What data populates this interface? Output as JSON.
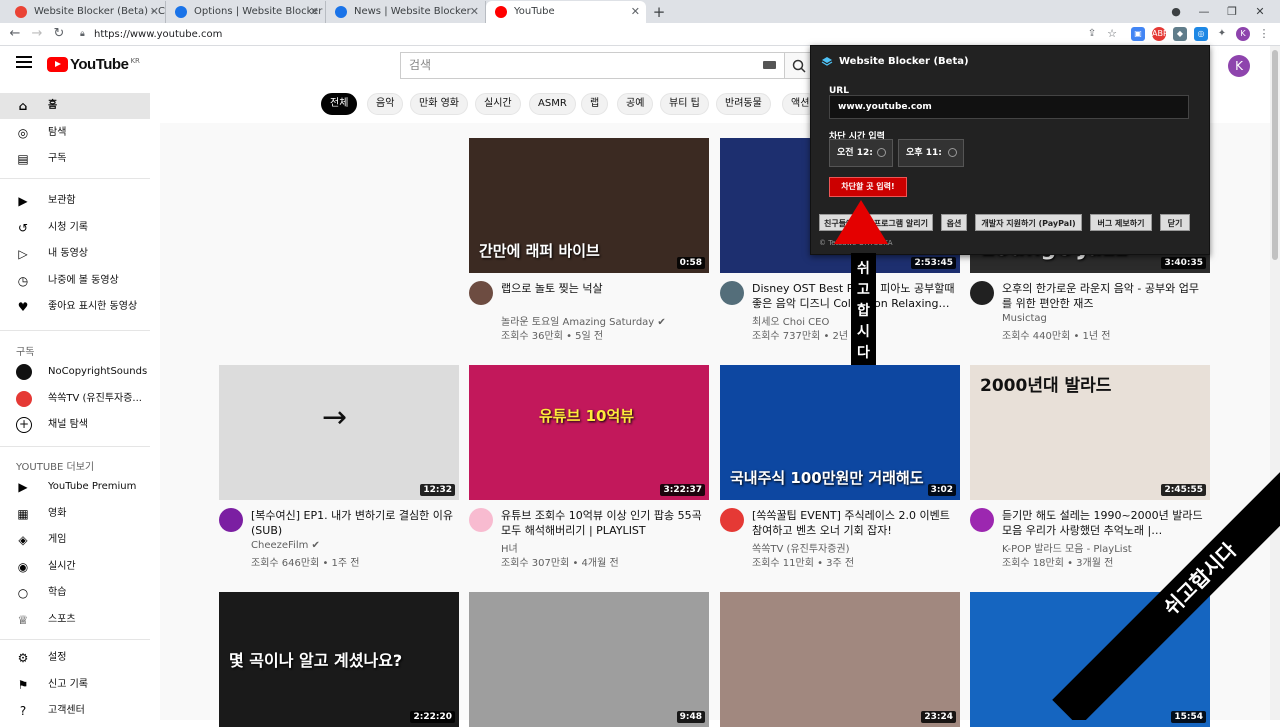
{
  "browser": {
    "tabs": [
      {
        "title": "Website Blocker (Beta) - Chrom",
        "fav_color": "#ea4335"
      },
      {
        "title": "Options | Website Blocker",
        "fav_color": "#1a73e8"
      },
      {
        "title": "News | Website Blocker",
        "fav_color": "#1a73e8"
      },
      {
        "title": "YouTube",
        "fav_color": "#ff0000"
      }
    ],
    "new_tab": "+",
    "url": "https://www.youtube.com",
    "profile_letter": "K",
    "nav": {
      "back": "←",
      "forward": "→",
      "reload": "↻"
    }
  },
  "youtube": {
    "logo_text": "YouTube",
    "logo_region": "KR",
    "search_placeholder": "검색",
    "avatar_letter": "K",
    "chips": [
      "전체",
      "음악",
      "만화 영화",
      "실시간",
      "ASMR",
      "랩",
      "공예",
      "뷰티 팁",
      "반려동물",
      "액션"
    ],
    "sidebar": {
      "main": [
        {
          "label": "홈",
          "icon": "home-icon",
          "glyph": "⌂"
        },
        {
          "label": "탐색",
          "icon": "compass-icon",
          "glyph": "◎"
        },
        {
          "label": "구독",
          "icon": "subscriptions-icon",
          "glyph": "▤"
        }
      ],
      "library": [
        {
          "label": "보관함",
          "icon": "library-icon",
          "glyph": "▶"
        },
        {
          "label": "시청 기록",
          "icon": "history-icon",
          "glyph": "↺"
        },
        {
          "label": "내 동영상",
          "icon": "my-videos-icon",
          "glyph": "▷"
        },
        {
          "label": "나중에 볼 동영상",
          "icon": "watch-later-icon",
          "glyph": "◷"
        },
        {
          "label": "좋아요 표시한 동영상",
          "icon": "liked-icon",
          "glyph": "♥"
        }
      ],
      "subs_heading": "구독",
      "subs": [
        {
          "label": "NoCopyrightSounds",
          "color": "#111111"
        },
        {
          "label": "쏙쏙TV (유진투자증...",
          "color": "#e53935"
        },
        {
          "label": "채널 탐색",
          "color": "#ffffff"
        }
      ],
      "more_heading": "YOUTUBE 더보기",
      "more": [
        {
          "label": "YouTube Premium",
          "icon": "youtube-premium-icon",
          "glyph": "▶"
        },
        {
          "label": "영화",
          "icon": "movies-icon",
          "glyph": "▦"
        },
        {
          "label": "게임",
          "icon": "gaming-icon",
          "glyph": "◈"
        },
        {
          "label": "실시간",
          "icon": "live-icon",
          "glyph": "◉"
        },
        {
          "label": "학습",
          "icon": "learning-icon",
          "glyph": "○"
        },
        {
          "label": "스포츠",
          "icon": "sports-icon",
          "glyph": "♕"
        }
      ],
      "settings": [
        {
          "label": "설정",
          "icon": "settings-icon",
          "glyph": "⚙"
        },
        {
          "label": "신고 기록",
          "icon": "flag-icon",
          "glyph": "⚑"
        },
        {
          "label": "고객센터",
          "icon": "help-icon",
          "glyph": "?"
        }
      ]
    },
    "videos": [
      {
        "title": "랩으로 놀토 찢는 넉살",
        "channel": "놀라운 토요일 Amazing Saturday ✔",
        "meta": "조회수 36만회 • 5일 전",
        "duration": "0:58",
        "thumb_text": "간만에 래퍼 바이브",
        "thumb_color": "#3b2a22",
        "avatar": "#6d4c41"
      },
      {
        "title": "Disney OST Best Piano 피아노 공부할때 좋은 음악 디즈니 Collection Relaxing…",
        "channel": "최세오 Choi CEO",
        "meta": "조회수 737만회 • 2년 전",
        "duration": "2:53:45",
        "thumb_text": "",
        "thumb_color": "#1d2f6f",
        "avatar": "#546e7a"
      },
      {
        "title": "오후의 한가로운 라운지 음악 - 공부와 업무를 위한 편안한 재즈",
        "channel": "Musictag",
        "meta": "조회수 440만회 • 1년 전",
        "duration": "3:40:35",
        "thumb_text": "Lounge Jazz",
        "thumb_color": "#2b2b2b",
        "avatar": "#212121"
      },
      {
        "title": "[복수여신] EP1. 내가 변하기로 결심한 이유 (SUB)",
        "channel": "CheezeFilm ✔",
        "meta": "조회수 646만회 • 1주 전",
        "duration": "12:32",
        "thumb_text": "",
        "thumb_color": "#dcdcdc",
        "avatar": "#7b1fa2"
      },
      {
        "title": "유튜브 조회수 10억뷰 이상 인기 팝송 55곡 모두 해석해버리기 | PLAYLIST",
        "channel": "H녀",
        "meta": "조회수 307만회 • 4개월 전",
        "duration": "3:22:37",
        "thumb_text": "유튜브 10억뷰",
        "thumb_color": "#c2185b",
        "avatar": "#f8bbd0"
      },
      {
        "title": "[쏙쏙꿀팁 EVENT] 주식레이스 2.0 이벤트 참여하고 벤츠 오너 기회 잡자!",
        "channel": "쏙쏙TV (유진투자증권)",
        "meta": "조회수 11만회 • 3주 전",
        "duration": "3:02",
        "thumb_text": "국내주식 100만원만 거래해도",
        "thumb_color": "#0d47a1",
        "avatar": "#e53935"
      },
      {
        "title": "듣기만 해도 설레는 1990~2000년 발라드모음 우리가 사랑했던 추억노래 |…",
        "channel": "K-POP 발라드 모음 - PlayList",
        "meta": "조회수 18만회 • 3개월 전",
        "duration": "2:45:55",
        "thumb_text": "2000년대 발라드",
        "thumb_color": "#e8e0d8",
        "avatar": "#9c27b0"
      },
      {
        "title": "",
        "channel": "",
        "meta": "",
        "duration": "2:22:20",
        "thumb_text": "몇 곡이나 알고 계셨나요?",
        "thumb_color": "#1a1a1a",
        "avatar": "#000000"
      },
      {
        "title": "",
        "channel": "",
        "meta": "",
        "duration": "9:48",
        "thumb_text": "",
        "thumb_color": "#9e9e9e",
        "avatar": "#000000"
      },
      {
        "title": "",
        "channel": "",
        "meta": "",
        "duration": "23:24",
        "thumb_text": "",
        "thumb_color": "#a1887f",
        "avatar": "#000000"
      },
      {
        "title": "",
        "channel": "",
        "meta": "",
        "duration": "15:54",
        "thumb_text": "",
        "thumb_color": "#1565c0",
        "avatar": "#000000"
      }
    ]
  },
  "popup": {
    "title": "Website Blocker (Beta)",
    "url_label": "URL",
    "url_value": "www.youtube.com",
    "time_label": "차단 시간 입력",
    "time_start": "오전 12:",
    "time_end": "오후 11:",
    "submit_label": "차단할 곳 입력!",
    "buttons": [
      "친구들에게 이 프로그램 알리기",
      "옵션",
      "개발자 지원하기 (PayPal)",
      "버그 제보하기",
      "닫기"
    ],
    "copyright": "© Tetsuwo OHTSUKA"
  },
  "annotations": {
    "vertical_label": [
      "쉬",
      "고",
      "합",
      "시",
      "다"
    ],
    "ribbon": "쉬고합시다",
    "arrow_color": "#e40000"
  }
}
